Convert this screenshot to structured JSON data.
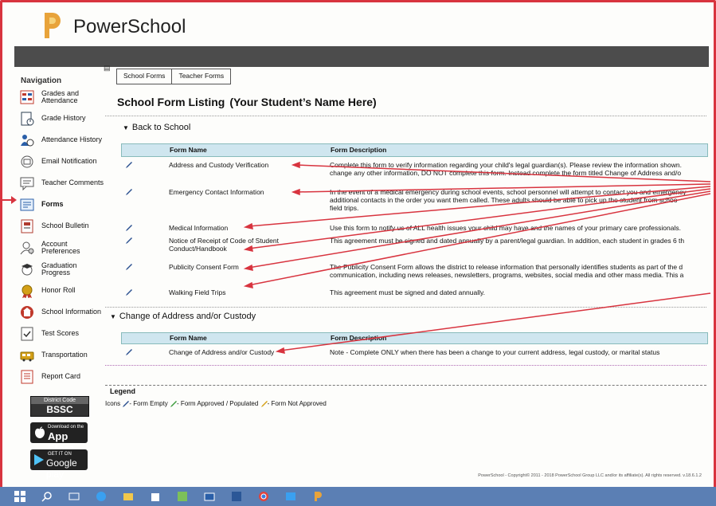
{
  "brand": {
    "name": "PowerSchool"
  },
  "nav": {
    "title": "Navigation",
    "items": [
      {
        "label": "Grades and Attendance",
        "icon": "grades-icon",
        "color": "#c0392b"
      },
      {
        "label": "Grade History",
        "icon": "grade-history-icon",
        "color": "#2c3e50"
      },
      {
        "label": "Attendance History",
        "icon": "attendance-history-icon",
        "color": "#2a5fa8"
      },
      {
        "label": "Email Notification",
        "icon": "email-icon",
        "color": "#555555"
      },
      {
        "label": "Teacher Comments",
        "icon": "comments-icon",
        "color": "#555555"
      },
      {
        "label": "Forms",
        "icon": "forms-icon",
        "color": "#2a5fa8"
      },
      {
        "label": "School Bulletin",
        "icon": "bulletin-icon",
        "color": "#b03a2e"
      },
      {
        "label": "Account Preferences",
        "icon": "account-icon",
        "color": "#555555"
      },
      {
        "label": "Graduation Progress",
        "icon": "graduation-icon",
        "color": "#555555"
      },
      {
        "label": "Honor Roll",
        "icon": "honor-roll-icon",
        "color": "#d4a017"
      },
      {
        "label": "School Information",
        "icon": "school-info-icon",
        "color": "#c0392b"
      },
      {
        "label": "Test Scores",
        "icon": "test-scores-icon",
        "color": "#555555"
      },
      {
        "label": "Transportation",
        "icon": "bus-icon",
        "color": "#d4a017"
      },
      {
        "label": "Report Card",
        "icon": "report-card-icon",
        "color": "#c0392b"
      }
    ]
  },
  "badges": {
    "district_code_label": "District Code",
    "district_code": "BSSC",
    "appstore_small": "Download on the",
    "appstore": "App Store",
    "play_small": "GET IT ON",
    "play": "Google play"
  },
  "tabs": [
    "School Forms",
    "Teacher Forms"
  ],
  "page": {
    "title": "School Form Listing",
    "student": "(Your Student’s Name Here)"
  },
  "sections": [
    {
      "title": "Back to School",
      "col_name": "Form Name",
      "col_desc": "Form Description",
      "rows": [
        {
          "name": "Address and Custody Verification",
          "desc": "Complete this form to verify information regarding your child's legal guardian(s). Please review the information shown.",
          "desc2": "change any other information, DO NOT complete this form. Instead complete the form titled Change of Address and/o"
        },
        {
          "name": "Emergency Contact Information",
          "desc": "In the event of a medical emergency during school events, school personnel will attempt to contact you and emergency",
          "desc2": "additional contacts in the order you want them called. These adults should be able to pick up the student from schoo",
          "desc3": "field trips."
        },
        {
          "name": "Medical Information",
          "desc": "Use this form to notify us of ALL health issues your child may have and the names of your primary care professionals."
        },
        {
          "name": "Notice of Receipt of Code of Student Conduct/Handbook",
          "desc": "This agreement must be signed and dated annually by a parent/legal guardian. In addition, each student in grades 6 th"
        },
        {
          "name": "Publicity Consent Form",
          "desc": "The Publicity Consent Form allows the district to release information that personally identifies students as part of the d",
          "desc2": "communication, including news releases, newsletters, programs, websites, social media and other mass media. This a"
        },
        {
          "name": "Walking Field Trips",
          "desc": "This agreement must be signed and dated annually."
        }
      ]
    },
    {
      "title": "Change of Address and/or Custody",
      "col_name": "Form Name",
      "col_desc": "Form Description",
      "rows": [
        {
          "name": "Change of Address and/or Custody",
          "desc": "Note - Complete ONLY when there has been a change to your current address, legal custody, or marital status"
        }
      ]
    }
  ],
  "legend": {
    "title": "Legend",
    "icons_label": "Icons",
    "empty": "- Form Empty",
    "approved": "- Form Approved / Populated",
    "not_approved": "- Form Not Approved",
    "colors": {
      "empty": "#2a4f8f",
      "approved": "#3a9a3a",
      "not_approved": "#d4a017"
    }
  },
  "footer": "PowerSchool - Copyright© 2011 - 2018 PowerSchool Group LLC and/or its affiliate(s). All rights reserved. v.18.6.1.2",
  "colors": {
    "accent": "#d8343f",
    "header_bar": "#4c4c4c",
    "table_header": "#cfe6ef",
    "taskbar": "#5b7fb4"
  }
}
